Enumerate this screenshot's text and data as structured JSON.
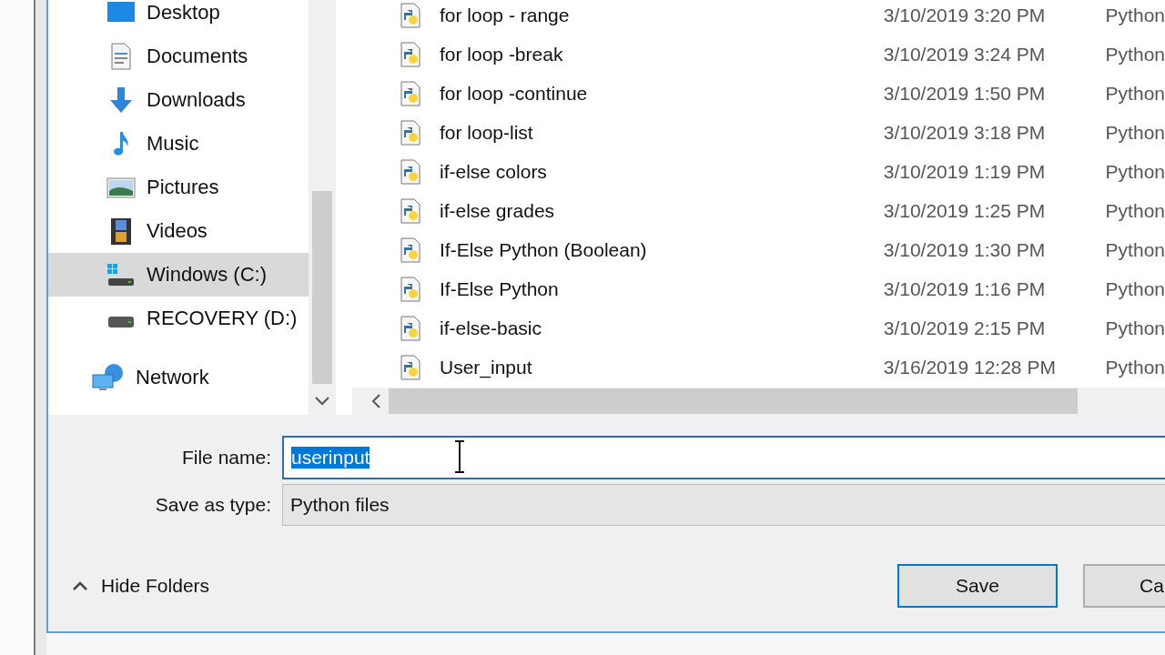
{
  "navigation": {
    "items": [
      {
        "label": "Desktop",
        "kind": "desktop",
        "selected": false
      },
      {
        "label": "Documents",
        "kind": "documents",
        "selected": false
      },
      {
        "label": "Downloads",
        "kind": "downloads",
        "selected": false
      },
      {
        "label": "Music",
        "kind": "music",
        "selected": false
      },
      {
        "label": "Pictures",
        "kind": "pictures",
        "selected": false
      },
      {
        "label": "Videos",
        "kind": "videos",
        "selected": false
      },
      {
        "label": "Windows (C:)",
        "kind": "system-drive",
        "selected": true
      },
      {
        "label": "RECOVERY (D:)",
        "kind": "drive",
        "selected": false
      }
    ],
    "network": {
      "label": "Network"
    }
  },
  "files": [
    {
      "name": "for loop - range",
      "date": "3/10/2019 3:20 PM",
      "type": "Python"
    },
    {
      "name": "for loop -break",
      "date": "3/10/2019 3:24 PM",
      "type": "Python"
    },
    {
      "name": "for loop -continue",
      "date": "3/10/2019 1:50 PM",
      "type": "Python"
    },
    {
      "name": "for loop-list",
      "date": "3/10/2019 3:18 PM",
      "type": "Python"
    },
    {
      "name": "if-else colors",
      "date": "3/10/2019 1:19 PM",
      "type": "Python"
    },
    {
      "name": "if-else grades",
      "date": "3/10/2019 1:25 PM",
      "type": "Python"
    },
    {
      "name": "If-Else Python (Boolean)",
      "date": "3/10/2019 1:30 PM",
      "type": "Python"
    },
    {
      "name": "If-Else Python",
      "date": "3/10/2019 1:16 PM",
      "type": "Python"
    },
    {
      "name": "if-else-basic",
      "date": "3/10/2019 2:15 PM",
      "type": "Python"
    },
    {
      "name": "User_input",
      "date": "3/16/2019 12:28 PM",
      "type": "Python"
    }
  ],
  "file_name": {
    "label": "File name:",
    "value": "userinput",
    "value_selected": true
  },
  "save_as_type": {
    "label": "Save as type:",
    "value": "Python files"
  },
  "hide_folders": {
    "label": "Hide Folders"
  },
  "buttons": [
    {
      "label": "Save",
      "default": true
    },
    {
      "label": "Ca",
      "default": false
    }
  ]
}
